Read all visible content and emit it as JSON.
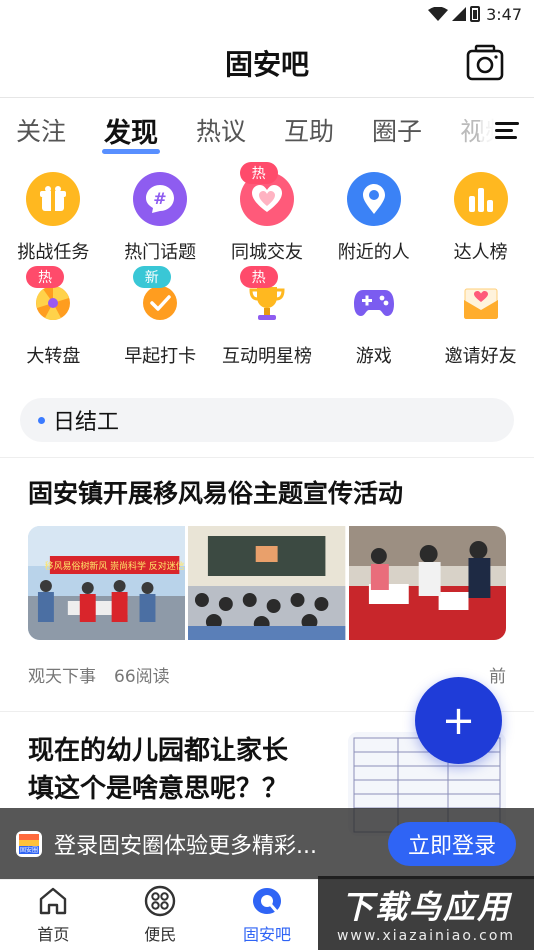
{
  "status": {
    "time": "3:47"
  },
  "header": {
    "title": "固安吧"
  },
  "tabs": [
    {
      "label": "关注"
    },
    {
      "label": "发现"
    },
    {
      "label": "热议"
    },
    {
      "label": "互助"
    },
    {
      "label": "圈子"
    },
    {
      "label": "视频"
    }
  ],
  "grid": [
    {
      "label": "挑战任务",
      "icon": "gift-icon",
      "color": "#ffb820"
    },
    {
      "label": "热门话题",
      "icon": "hashtag-icon",
      "color": "#8e5cf0"
    },
    {
      "label": "同城交友",
      "icon": "heart-icon",
      "color": "#ff5a7a",
      "badge": "热"
    },
    {
      "label": "附近的人",
      "icon": "location-pin-icon",
      "color": "#3b82f6"
    },
    {
      "label": "达人榜",
      "icon": "bar-chart-icon",
      "color": "#ffb820"
    },
    {
      "label": "大转盘",
      "icon": "wheel-icon",
      "color": "#ff9d1f",
      "badge": "热"
    },
    {
      "label": "早起打卡",
      "icon": "check-circle-icon",
      "color": "#ff9d1f",
      "badge": "新"
    },
    {
      "label": "互动明星榜",
      "icon": "trophy-icon",
      "color": "#ffb820",
      "badge": "热"
    },
    {
      "label": "游戏",
      "icon": "gamepad-icon",
      "color": "#7b5cf0"
    },
    {
      "label": "邀请好友",
      "icon": "envelope-icon",
      "color": "#ff9d1f"
    }
  ],
  "tag": {
    "label": "日结工"
  },
  "post1": {
    "title": "固安镇开展移风易俗主题宣传活动",
    "source": "观天下事",
    "reads": "66阅读",
    "time": "前",
    "banner_text": "移风易俗树新风  崇尚科学  反对迷信"
  },
  "post2": {
    "title": "现在的幼儿园都让家长填这个是啥意思呢？？"
  },
  "fab": {
    "label": "+"
  },
  "login": {
    "text": "登录固安圈体验更多精彩...",
    "button": "立即登录",
    "icon_text": "固安圈"
  },
  "bottom_nav": [
    {
      "label": "首页",
      "icon": "home-icon"
    },
    {
      "label": "便民",
      "icon": "grid-apps-icon"
    },
    {
      "label": "固安吧",
      "icon": "chat-bubble-icon"
    }
  ],
  "watermark": {
    "big": "下载鸟应用",
    "small": "www.xiazainiao.com"
  },
  "colors": {
    "accent": "#2f64f5",
    "fab": "#1f3cd8",
    "hot": "#ff4b6b",
    "new": "#39c7d6"
  }
}
